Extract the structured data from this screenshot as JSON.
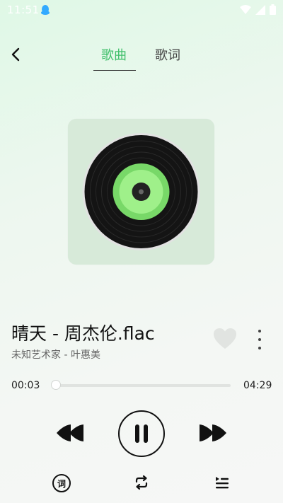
{
  "status": {
    "time": "11:51"
  },
  "nav": {
    "tab_song": "歌曲",
    "tab_lyric": "歌词"
  },
  "song": {
    "title": "晴天 - 周杰伦.flac",
    "artist": "未知艺术家 - 叶惠美"
  },
  "progress": {
    "current": "00:03",
    "total": "04:29",
    "value": 0.011
  },
  "controls": {
    "lyric_label": "词"
  },
  "colors": {
    "accent": "#3fbf6a",
    "disc_center": "#8ee87f"
  }
}
